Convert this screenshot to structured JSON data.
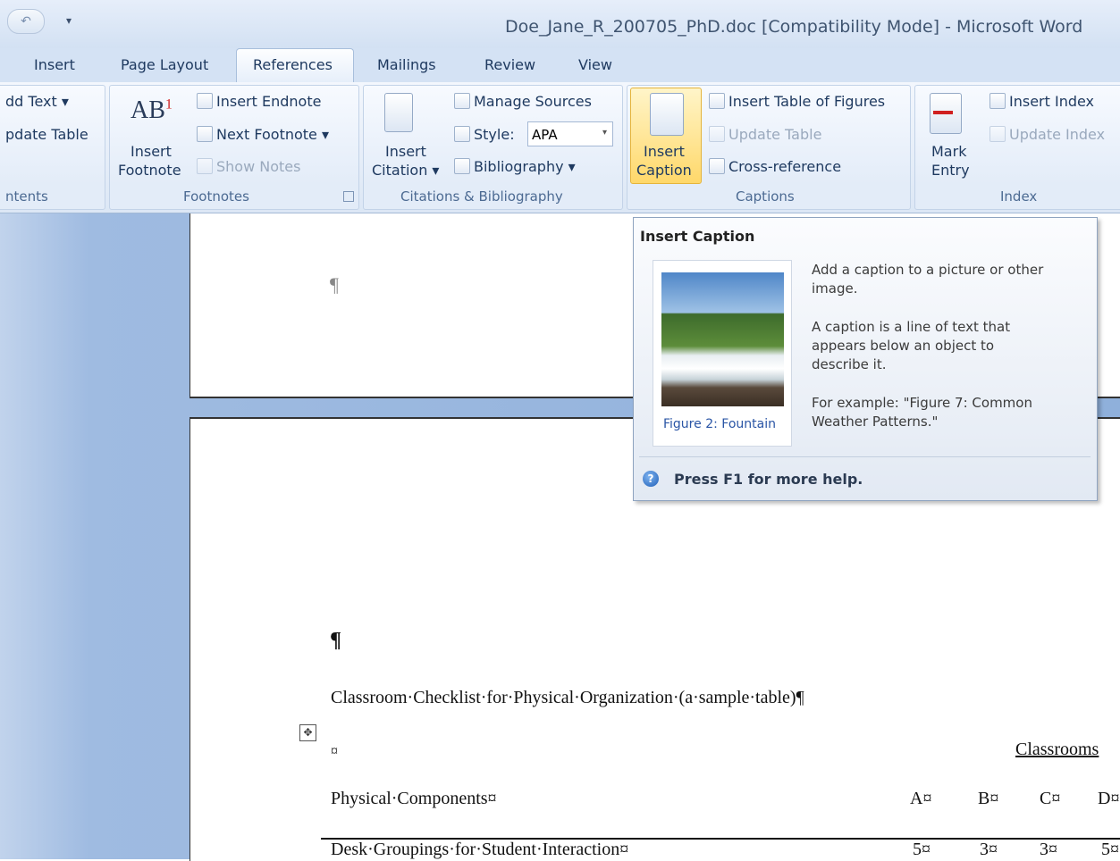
{
  "window": {
    "title": "Doe_Jane_R_200705_PhD.doc [Compatibility Mode] - Microsoft Word",
    "undo_glyph": "↶",
    "qat_more_glyph": "▾"
  },
  "tabs": [
    {
      "label": "Insert"
    },
    {
      "label": "Page Layout"
    },
    {
      "label": "References"
    },
    {
      "label": "Mailings"
    },
    {
      "label": "Review"
    },
    {
      "label": "View"
    }
  ],
  "ribbon": {
    "toc": {
      "add_text": "dd Text ▾",
      "update_table": "pdate Table",
      "label": "ntents"
    },
    "footnotes": {
      "insert_footnote_line1": "Insert",
      "insert_footnote_line2": "Footnote",
      "ab_glyph": "AB",
      "sup_glyph": "1",
      "insert_endnote": "Insert Endnote",
      "next_footnote": "Next Footnote ▾",
      "show_notes": "Show Notes",
      "label": "Footnotes"
    },
    "citations": {
      "insert_citation_line1": "Insert",
      "insert_citation_line2": "Citation ▾",
      "manage_sources": "Manage Sources",
      "style_label": "Style:",
      "style_value": "APA",
      "bibliography": "Bibliography ▾",
      "label": "Citations & Bibliography"
    },
    "captions": {
      "insert_caption_line1": "Insert",
      "insert_caption_line2": "Caption",
      "insert_table_of_figures": "Insert Table of Figures",
      "update_table": "Update Table",
      "cross_reference": "Cross-reference",
      "label": "Captions"
    },
    "index": {
      "mark_entry_line1": "Mark",
      "mark_entry_line2": "Entry",
      "insert_index": "Insert Index",
      "update_index": "Update Index",
      "label": "Index"
    }
  },
  "tooltip": {
    "title": "Insert Caption",
    "figure_caption": "Figure 2: Fountain",
    "para1": "Add a caption to a picture or other image.",
    "para2": "A caption is a line of text that appears below an object to describe it.",
    "para3": "For example: \"Figure 7: Common Weather Patterns.\"",
    "help_text": "Press F1 for more help.",
    "help_glyph": "?"
  },
  "document": {
    "pilcrow": "¶",
    "caption": "Classroom·Checklist·for·Physical·Organization·(a·sample·table)¶",
    "move_handle": "✥",
    "cell_mark": "¤",
    "classrooms_header": "Classrooms",
    "header_row": {
      "label": "Physical·Components¤",
      "a": "A¤",
      "b": "B¤",
      "c": "C¤",
      "d": "D¤"
    },
    "row1": {
      "label": "Desk·Groupings·for·Student·Interaction¤",
      "a": "5¤",
      "b": "3¤",
      "c": "3¤",
      "d": "5¤"
    }
  }
}
